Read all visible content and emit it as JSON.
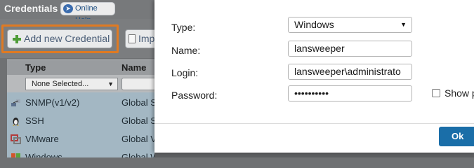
{
  "background": {
    "title": "Credentials",
    "help_label": "Online Help",
    "toolbar": {
      "add_label": "Add new Credential",
      "import_label": "Imp"
    },
    "grid": {
      "columns": [
        "Type",
        "Name"
      ],
      "filter_value": "None Selected...",
      "rows": [
        {
          "type": "SNMP(v1/v2)",
          "name": "Global S",
          "icon": "network-icon"
        },
        {
          "type": "SSH",
          "name": "Global S",
          "icon": "linux-penguin-icon"
        },
        {
          "type": "VMware",
          "name": "Global V",
          "icon": "vmware-icon"
        },
        {
          "type": "Windows",
          "name": "Global Windows",
          "icon": "windows-icon"
        }
      ]
    },
    "highlight_color": "#e07a22"
  },
  "dialog": {
    "type_label": "Type:",
    "type_value": "Windows",
    "name_label": "Name:",
    "name_value": "lansweeper",
    "login_label": "Login:",
    "login_value": "lansweeper\\administrato",
    "password_label": "Password:",
    "password_value": "••••••••••",
    "show_label": "Show p",
    "ok_label": "Ok",
    "accent_color": "#1a6ea8"
  }
}
